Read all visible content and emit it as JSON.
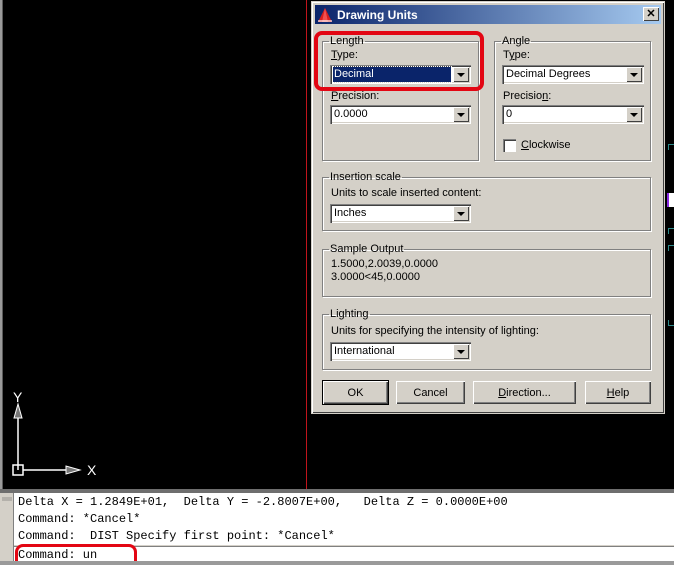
{
  "dialog": {
    "title": "Drawing Units",
    "close_label": "✕",
    "length": {
      "group_label": "Length",
      "type_label_accel": "T",
      "type_label_rest": "ype:",
      "type_value": "Decimal",
      "precision_label_accel": "P",
      "precision_label_rest": "recision:",
      "precision_value": "0.0000"
    },
    "angle": {
      "group_label": "Angle",
      "type_label_pre": "T",
      "type_label_accel": "y",
      "type_label_rest": "pe:",
      "type_value": "Decimal Degrees",
      "precision_label_pre": "Precisio",
      "precision_label_accel": "n",
      "precision_label_rest": ":",
      "precision_value": "0",
      "clockwise_accel": "C",
      "clockwise_rest": "lockwise",
      "clockwise_checked": false
    },
    "insertion_scale": {
      "group_label": "Insertion scale",
      "description": "Units to scale inserted content:",
      "value": "Inches"
    },
    "sample_output": {
      "group_label": "Sample Output",
      "line1": "1.5000,2.0039,0.0000",
      "line2": "3.0000<45,0.0000"
    },
    "lighting": {
      "group_label": "Lighting",
      "description": "Units for specifying the intensity of lighting:",
      "value": "International"
    },
    "buttons": {
      "ok": "OK",
      "cancel": "Cancel",
      "direction_accel": "D",
      "direction_rest": "irection...",
      "help_accel": "H",
      "help_rest": "elp"
    }
  },
  "ucs": {
    "x_label": "X",
    "y_label": "Y"
  },
  "command_window": {
    "history": [
      "Delta X = 1.2849E+01,  Delta Y = -2.8007E+00,   Delta Z = 0.0000E+00",
      "Command: *Cancel*",
      "Command:  DIST Specify first point: *Cancel*"
    ],
    "prompt": "Command: un"
  },
  "colors": {
    "highlight": "#e30613",
    "titlebar_start": "#0a246a",
    "titlebar_end": "#a6caf0",
    "crosshair": "#c0141c",
    "canvas": "#000000",
    "dialog_face": "#d4d0c8"
  }
}
